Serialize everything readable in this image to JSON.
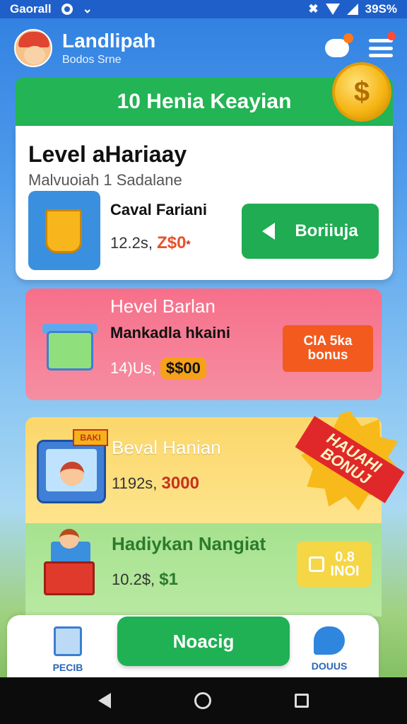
{
  "status_bar": {
    "carrier": "Gaorall",
    "battery": "39S%"
  },
  "header": {
    "app_name": "Landlipah",
    "app_subtitle": "Bodos Srne"
  },
  "banner": {
    "title": "10 Henia Keayian",
    "coin_symbol": "$"
  },
  "main_card": {
    "title": "Level aHariaay",
    "subtitle": "Malvuoiah 1 Sadalane",
    "item_name": "Caval Fariani",
    "item_meta": "12.2s,",
    "item_price": "Z$0",
    "item_price_mark": "*",
    "button_label": "Boriiuja"
  },
  "pink_card": {
    "title": "Hevel Barlan",
    "item_name": "Mankadla hkaini",
    "item_meta": "14)Us,",
    "item_price": "$$00",
    "badge_line1": "CIA 5ka",
    "badge_line2": "bonus"
  },
  "yellow_card": {
    "title": "Beval Hanian",
    "item_meta": "1192s,",
    "item_price": "3000",
    "thumb_sign": "BAKI",
    "burst_line1": "HAUAHI",
    "burst_line2": "BONUJ"
  },
  "green_card": {
    "title": "Hadiykan Nangiat",
    "item_meta": "10.2$,",
    "item_price": "$1",
    "badge_line1": "0.8",
    "badge_line2": "INOI"
  },
  "bottom_nav": {
    "left_label": "PECIB",
    "center_label": "Noacig",
    "right_label": "DOUUS"
  },
  "colors": {
    "primary_green": "#1fb153",
    "status_blue": "#1f5fc9",
    "accent_orange": "#f25a1e"
  }
}
